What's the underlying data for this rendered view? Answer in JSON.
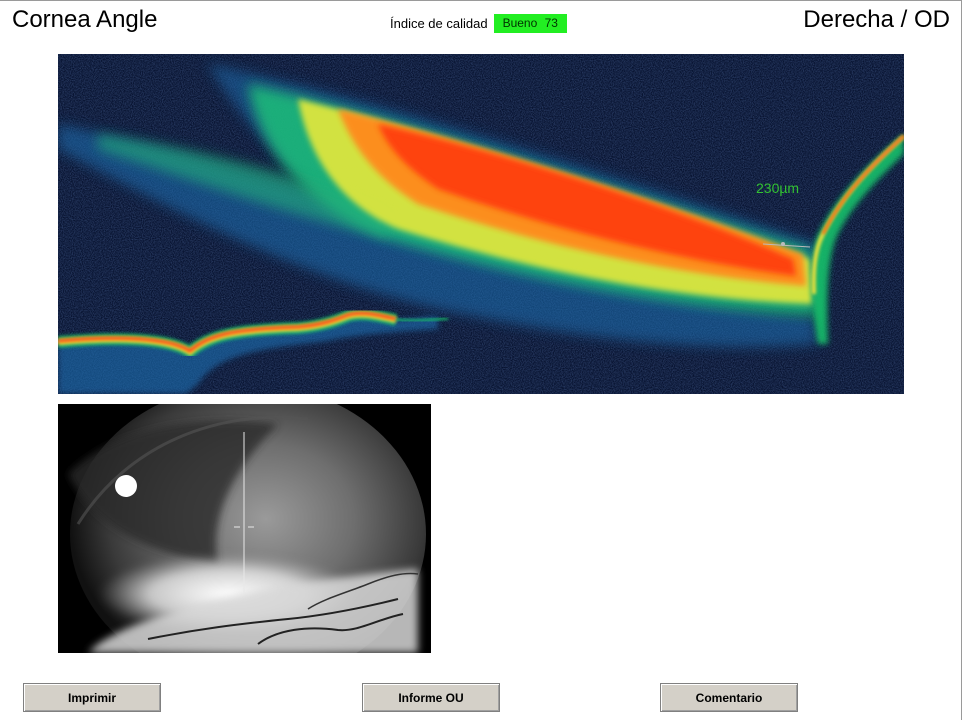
{
  "header": {
    "title": "Cornea Angle",
    "eye": "Derecha / OD",
    "quality_label": "Índice de calidad",
    "quality_value": "Bueno 73",
    "quality_color": "#22ee22"
  },
  "oct_scan": {
    "measurement": "230µm",
    "measurement_color": "#33c233"
  },
  "buttons": {
    "print": "Imprimir",
    "report": "Informe OU",
    "comment": "Comentario"
  }
}
